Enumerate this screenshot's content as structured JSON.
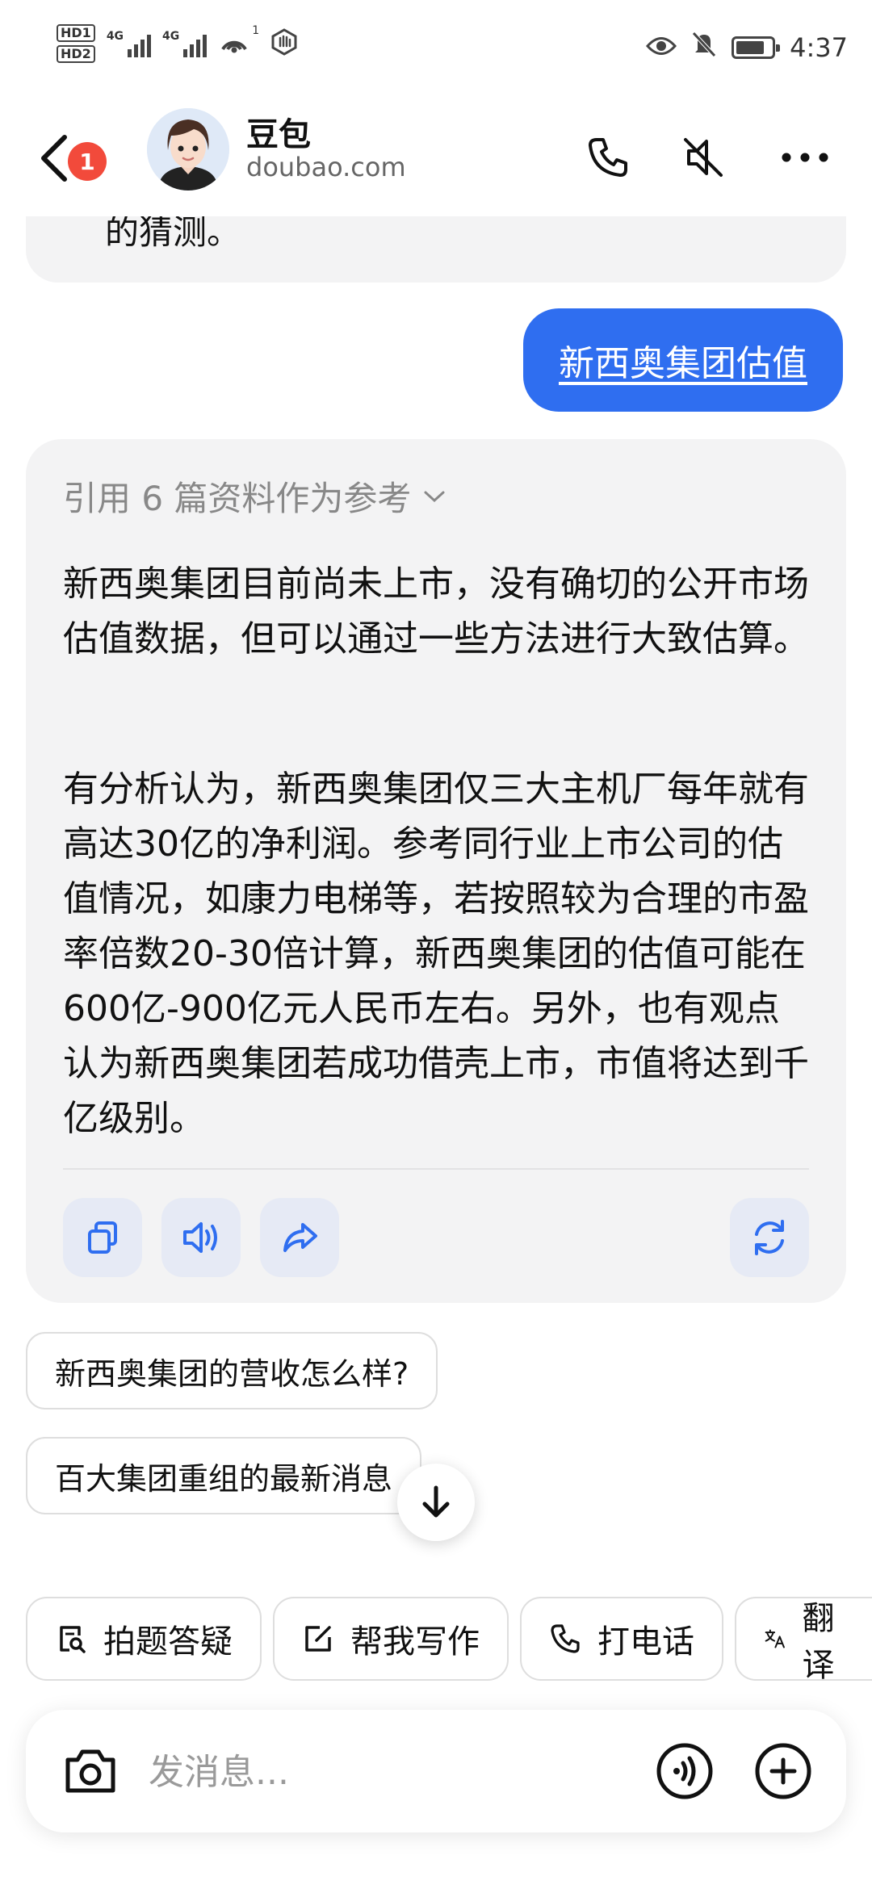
{
  "status_bar": {
    "time": "4:37",
    "hd1": "HD1",
    "hd2": "HD2",
    "net1": "4G",
    "net2": "4G",
    "wifi_sup": "1"
  },
  "header": {
    "badge_count": "1",
    "title": "豆包",
    "subtitle": "doubao.com"
  },
  "chat": {
    "previous_tail": "的猜测。",
    "user_message": "新西奥集团估值",
    "ai_reply": {
      "references_label": "引用 6 篇资料作为参考",
      "paragraphs": [
        "新西奥集团目前尚未上市，没有确切的公开市场估值数据，但可以通过一些方法进行大致估算。",
        "有分析认为，新西奥集团仅三大主机厂每年就有高达30亿的净利润。参考同行业上市公司的估值情况，如康力电梯等，若按照较为合理的市盈率倍数20-30倍计算，新西奥集团的估值可能在600亿-900亿元人民币左右。另外，也有观点认为新西奥集团若成功借壳上市，市值将达到千亿级别。"
      ],
      "actions": [
        "copy-icon",
        "speaker-icon",
        "share-icon",
        "regenerate-icon"
      ]
    },
    "suggestions": [
      "新西奥集团的营收怎么样?",
      "百大集团重组的最新消息"
    ]
  },
  "quick_actions": [
    {
      "label": "拍题答疑",
      "icon": "photo-search-icon"
    },
    {
      "label": "帮我写作",
      "icon": "edit-icon"
    },
    {
      "label": "打电话",
      "icon": "phone-icon"
    },
    {
      "label": "翻译",
      "icon": "translate-icon"
    }
  ],
  "composer": {
    "placeholder": "发消息..."
  },
  "colors": {
    "accent": "#2f6ef0",
    "bubble_bg": "#f3f3f4",
    "action_bg": "#e6eaf5",
    "badge": "#f24a3b"
  }
}
